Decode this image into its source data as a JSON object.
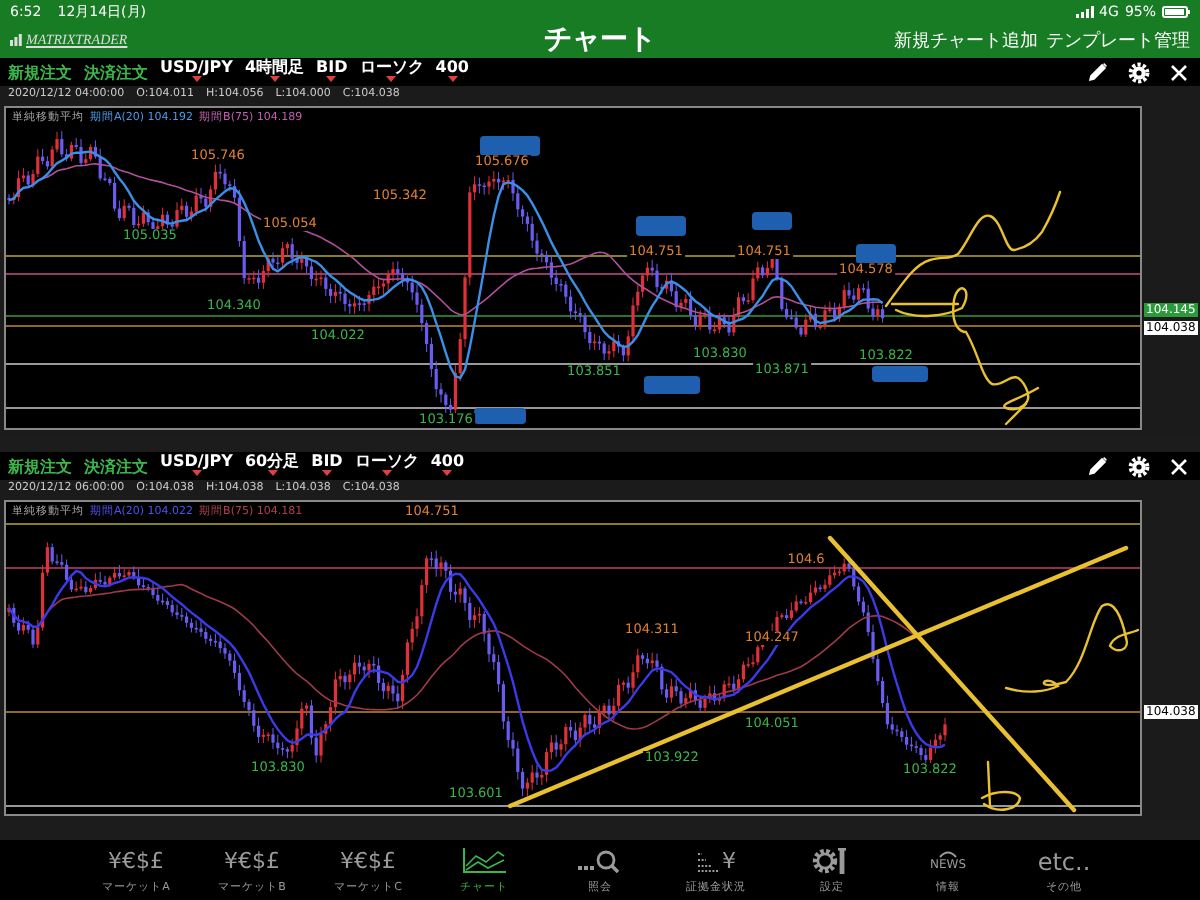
{
  "status_bar": {
    "time": "6:52",
    "date": "12月14日(月)",
    "network": "4G",
    "battery": "95%"
  },
  "header": {
    "logo": "MATRIXTRADER",
    "title": "チャート",
    "actions": [
      "新規チャート追加",
      "テンプレート管理"
    ]
  },
  "charts": [
    {
      "order_buttons": [
        "新規注文",
        "決済注文"
      ],
      "selectors": [
        "USD/JPY",
        "4時間足",
        "BID",
        "ローソク",
        "400"
      ],
      "ohlc": [
        "2020/12/12 04:00:00",
        "O:104.011",
        "H:104.056",
        "L:104.000",
        "C:104.038"
      ],
      "indicator": {
        "name": "単純移動平均",
        "ma_a": "期間A(20) 104.192",
        "ma_b": "期間B(75) 104.189"
      },
      "price_labels": [
        {
          "text": "105.746",
          "kind": "high"
        },
        {
          "text": "105.035",
          "kind": "low"
        },
        {
          "text": "105.054",
          "kind": "high"
        },
        {
          "text": "105.342",
          "kind": "high"
        },
        {
          "text": "104.340",
          "kind": "low"
        },
        {
          "text": "104.022",
          "kind": "low"
        },
        {
          "text": "103.176",
          "kind": "low"
        },
        {
          "text": "105.676",
          "kind": "high"
        },
        {
          "text": "104.751",
          "kind": "high"
        },
        {
          "text": "104.751",
          "kind": "high"
        },
        {
          "text": "104.578",
          "kind": "high"
        },
        {
          "text": "103.851",
          "kind": "low"
        },
        {
          "text": "103.830",
          "kind": "low"
        },
        {
          "text": "103.871",
          "kind": "low"
        },
        {
          "text": "103.822",
          "kind": "low"
        }
      ],
      "price_tags": [
        {
          "text": "104.145",
          "kind": "highlight"
        },
        {
          "text": "104.038",
          "kind": "plain"
        }
      ]
    },
    {
      "order_buttons": [
        "新規注文",
        "決済注文"
      ],
      "selectors": [
        "USD/JPY",
        "60分足",
        "BID",
        "ローソク",
        "400"
      ],
      "ohlc": [
        "2020/12/12 06:00:00",
        "O:104.038",
        "H:104.038",
        "L:104.038",
        "C:104.038"
      ],
      "indicator": {
        "name": "単純移動平均",
        "ma_a": "期間A(20) 104.022",
        "ma_b": "期間B(75) 104.181"
      },
      "price_labels": [
        {
          "text": "104.751",
          "kind": "high"
        },
        {
          "text": "104.6",
          "kind": "high"
        },
        {
          "text": "104.311",
          "kind": "high"
        },
        {
          "text": "104.247",
          "kind": "high"
        },
        {
          "text": "104.051",
          "kind": "low"
        },
        {
          "text": "103.922",
          "kind": "low"
        },
        {
          "text": "103.830",
          "kind": "low"
        },
        {
          "text": "103.822",
          "kind": "low"
        },
        {
          "text": "103.601",
          "kind": "low"
        }
      ],
      "price_tags": [
        {
          "text": "104.038",
          "kind": "plain"
        }
      ]
    }
  ],
  "tabs": [
    {
      "label": "マーケットA",
      "kind": "currency",
      "glyph": "¥€$£",
      "selected": false
    },
    {
      "label": "マーケットB",
      "kind": "currency",
      "glyph": "¥€$£",
      "selected": false
    },
    {
      "label": "マーケットC",
      "kind": "currency",
      "glyph": "¥€$£",
      "selected": false
    },
    {
      "label": "チャート",
      "kind": "chart",
      "selected": true
    },
    {
      "label": "照会",
      "kind": "search",
      "selected": false
    },
    {
      "label": "証拠金状況",
      "kind": "margin",
      "glyph": "¥",
      "selected": false
    },
    {
      "label": "設定",
      "kind": "settings",
      "selected": false
    },
    {
      "label": "情報",
      "kind": "news",
      "glyph": "NEWS",
      "selected": false
    },
    {
      "label": "その他",
      "kind": "etc",
      "glyph": "etc..",
      "selected": false
    }
  ]
}
